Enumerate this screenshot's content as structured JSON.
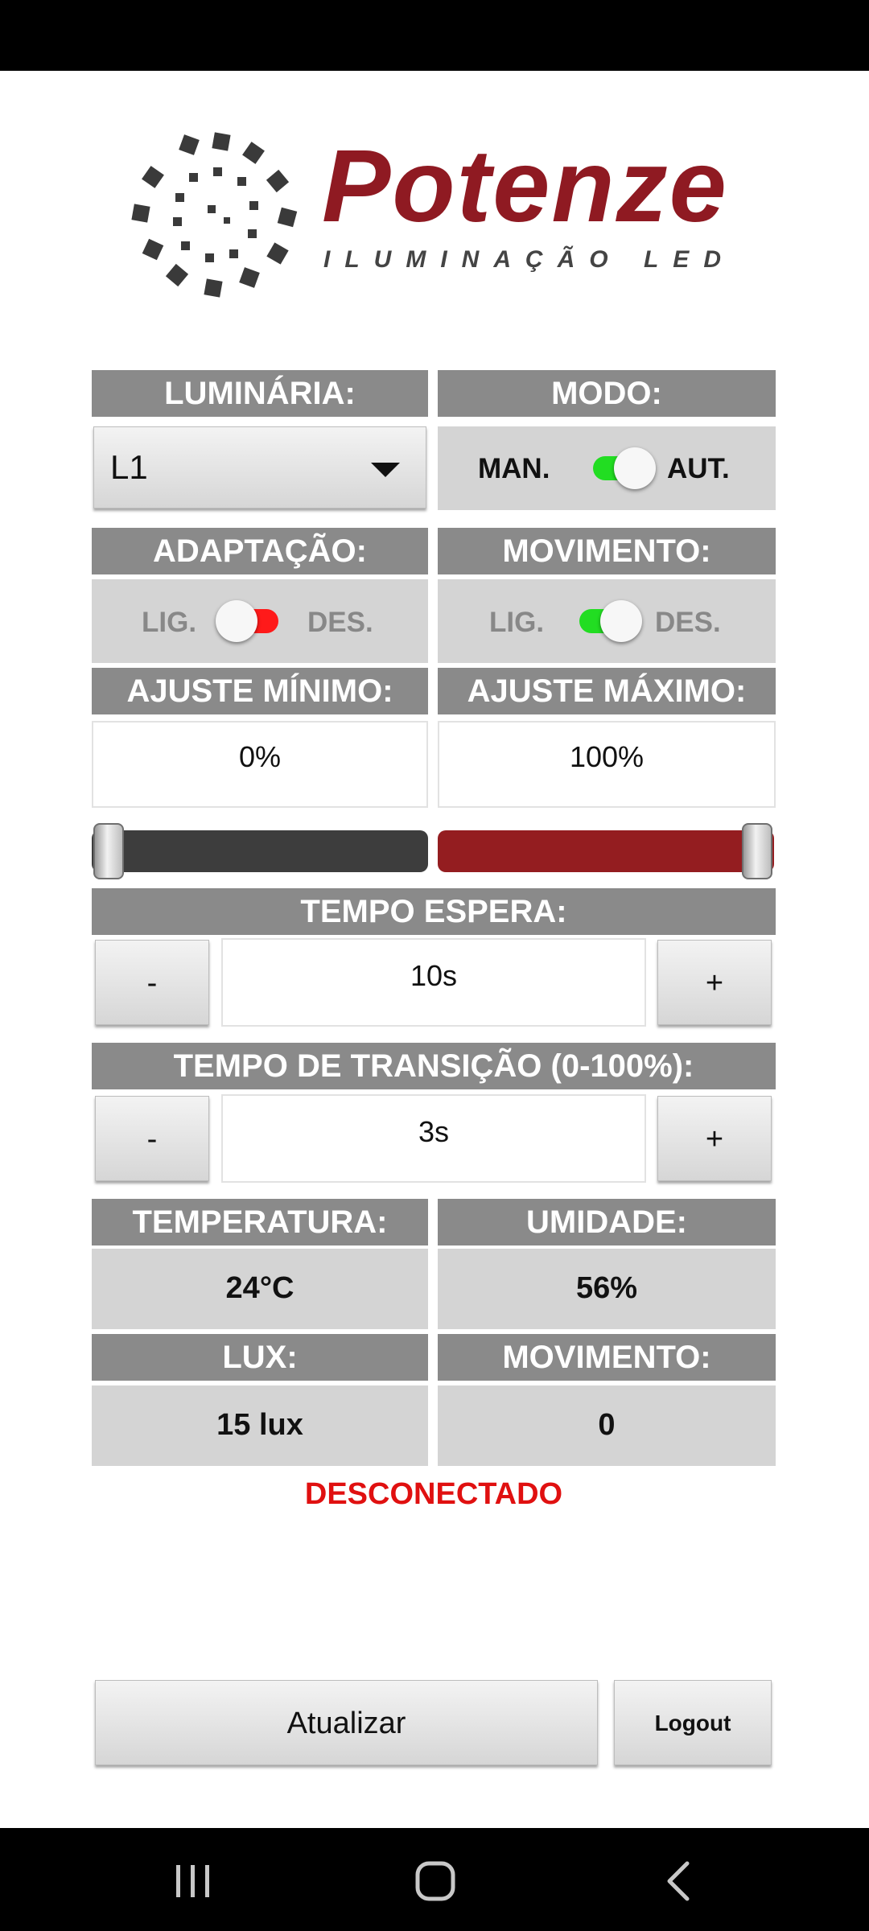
{
  "brand": {
    "name": "Potenze",
    "tagline": "ILUMINAÇÃO LED",
    "color": "#8f1a22"
  },
  "luminaria": {
    "label": "LUMINÁRIA:",
    "selected": "L1"
  },
  "modo": {
    "label": "MODO:",
    "left": "MAN.",
    "right": "AUT.",
    "on": true
  },
  "adaptacao": {
    "label": "ADAPTAÇÃO:",
    "left": "LIG.",
    "right": "DES.",
    "on": false
  },
  "movimento_toggle": {
    "label": "MOVIMENTO:",
    "left": "LIG.",
    "right": "DES.",
    "on": true
  },
  "ajuste": {
    "min_label": "AJUSTE MÍNIMO:",
    "min_value": "0%",
    "max_label": "AJUSTE MÁXIMO:",
    "max_value": "100%"
  },
  "tempo_espera": {
    "label": "TEMPO ESPERA:",
    "value": "10s",
    "minus": "-",
    "plus": "+"
  },
  "tempo_transicao": {
    "label": "TEMPO DE TRANSIÇÃO (0-100%):",
    "value": "3s",
    "minus": "-",
    "plus": "+"
  },
  "sensores": {
    "temperatura_label": "TEMPERATURA:",
    "temperatura": "24°C",
    "umidade_label": "UMIDADE:",
    "umidade": "56%",
    "lux_label": "LUX:",
    "lux": "15 lux",
    "movimento_label": "MOVIMENTO:",
    "movimento": "0"
  },
  "status": "DESCONECTADO",
  "buttons": {
    "atualizar": "Atualizar",
    "logout": "Logout"
  },
  "colors": {
    "on": "#22dd22",
    "off": "#ff1a1a",
    "header": "#8a8a8a",
    "status": "#e01010"
  }
}
